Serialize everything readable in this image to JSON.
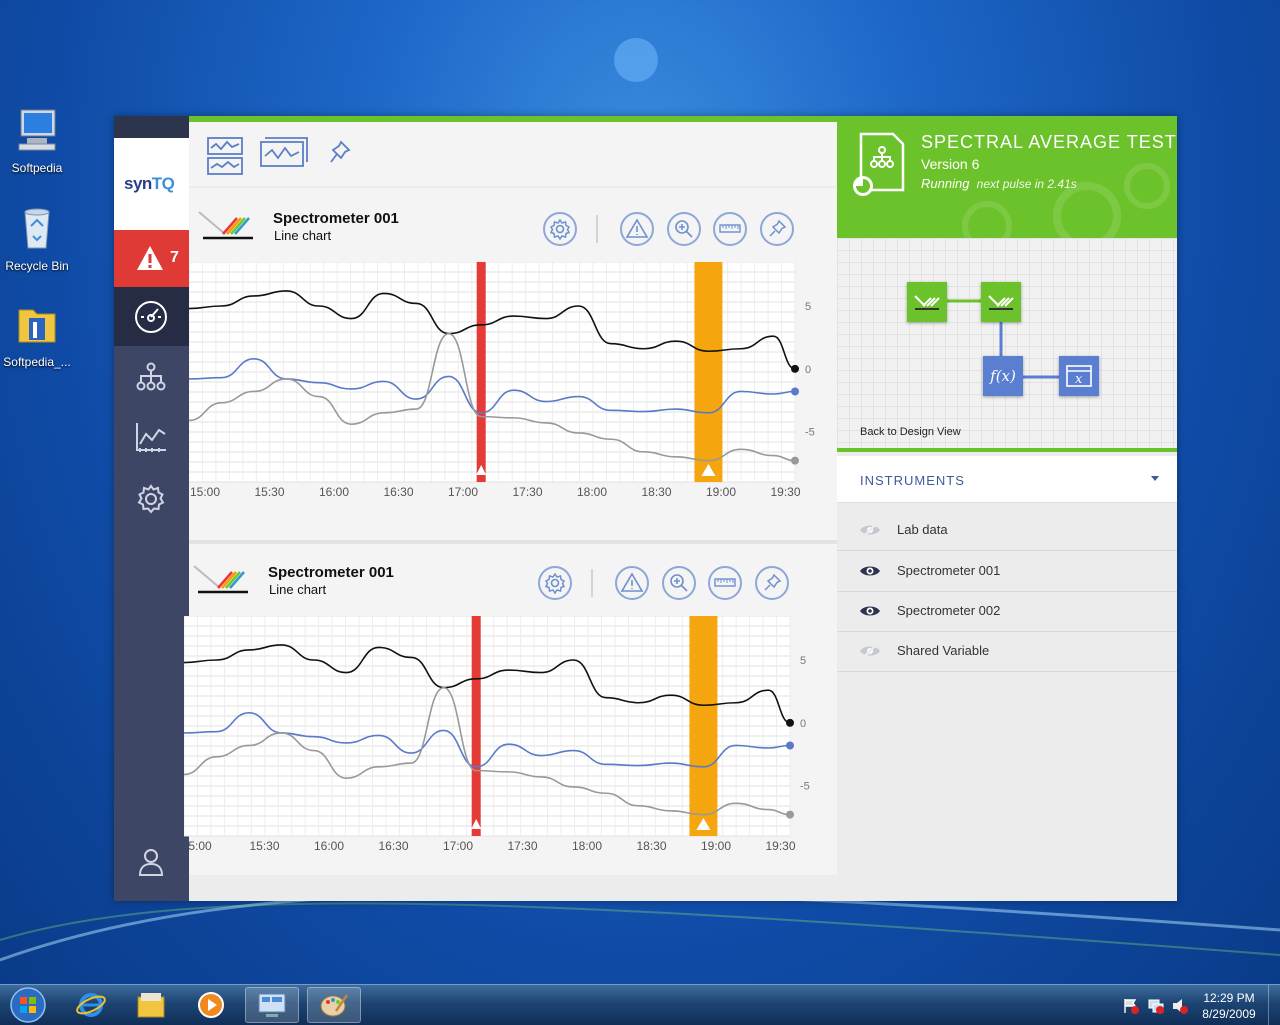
{
  "desktop": {
    "icons": [
      {
        "label": "Softpedia"
      },
      {
        "label": "Recycle Bin"
      },
      {
        "label": "Softpedia_..."
      }
    ]
  },
  "app": {
    "logo": {
      "prefix": "syn",
      "suffix": "TQ"
    },
    "alert_count": "7",
    "charts": [
      {
        "title": "Spectrometer 001",
        "subtitle": "Line chart",
        "x_ticks": [
          "15:00",
          "15:30",
          "16:00",
          "16:30",
          "17:00",
          "17:30",
          "18:00",
          "18:30",
          "19:00",
          "19:30"
        ],
        "y_ticks": [
          "5",
          "0",
          "-5"
        ]
      },
      {
        "title": "Spectrometer 001",
        "subtitle": "Line chart",
        "x_ticks": [
          "5:00",
          "15:30",
          "16:00",
          "16:30",
          "17:00",
          "17:30",
          "18:00",
          "18:30",
          "19:00",
          "19:30"
        ],
        "y_ticks": [
          "5",
          "0",
          "-5"
        ]
      }
    ],
    "chart_data": [
      {
        "type": "line",
        "title": "Spectrometer 001",
        "xlabel": "",
        "ylabel": "",
        "x": [
          "15:00",
          "15:15",
          "15:30",
          "15:45",
          "16:00",
          "16:15",
          "16:30",
          "16:45",
          "17:00",
          "17:15",
          "17:30",
          "17:45",
          "18:00",
          "18:15",
          "18:30",
          "18:45",
          "19:00",
          "19:15",
          "19:30",
          "19:40"
        ],
        "ylim": [
          -9,
          8.5
        ],
        "series": [
          {
            "color": "#111111",
            "values": [
              4.8,
              5.0,
              5.8,
              6.2,
              5.0,
              4.0,
              6.0,
              5.2,
              2.8,
              3.5,
              4.2,
              4.0,
              5.0,
              2.0,
              1.6,
              2.2,
              1.4,
              1.6,
              2.6,
              0.0
            ]
          },
          {
            "color": "#5a79c8",
            "values": [
              -0.8,
              -0.7,
              0.8,
              -0.8,
              -1.1,
              -1.6,
              -1.0,
              -2.4,
              -0.6,
              -3.5,
              -1.7,
              -2.6,
              -2.2,
              -3.3,
              -3.4,
              -3.2,
              -3.5,
              -1.8,
              -2.0,
              -1.8
            ]
          },
          {
            "color": "#999999",
            "values": [
              -4.1,
              -2.7,
              -1.8,
              -0.8,
              -2.2,
              -4.4,
              -3.5,
              -3.2,
              2.8,
              -3.8,
              -3.9,
              -4.3,
              -5.1,
              -5.6,
              -6.6,
              -7.0,
              -7.3,
              -6.4,
              -6.9,
              -7.3
            ]
          }
        ],
        "markers": [
          {
            "type": "alarm",
            "x": "17:15",
            "color": "#e53b36"
          },
          {
            "type": "warning",
            "x": "19:00",
            "color": "#f5a50d"
          }
        ]
      },
      {
        "type": "line",
        "title": "Spectrometer 001",
        "xlabel": "",
        "ylabel": "",
        "x": [
          "15:00",
          "15:15",
          "15:30",
          "15:45",
          "16:00",
          "16:15",
          "16:30",
          "16:45",
          "17:00",
          "17:15",
          "17:30",
          "17:45",
          "18:00",
          "18:15",
          "18:30",
          "18:45",
          "19:00",
          "19:15",
          "19:30",
          "19:40"
        ],
        "ylim": [
          -9,
          8.5
        ],
        "series": [
          {
            "color": "#111111",
            "values": [
              4.8,
              5.0,
              5.8,
              6.2,
              5.0,
              4.0,
              6.0,
              5.2,
              2.8,
              3.5,
              4.2,
              4.0,
              5.0,
              2.0,
              1.6,
              2.2,
              1.4,
              1.6,
              2.6,
              0.0
            ]
          },
          {
            "color": "#5a79c8",
            "values": [
              -0.8,
              -0.7,
              0.8,
              -0.8,
              -1.1,
              -1.6,
              -1.0,
              -2.4,
              -0.6,
              -3.5,
              -1.7,
              -2.6,
              -2.2,
              -3.3,
              -3.4,
              -3.2,
              -3.5,
              -1.8,
              -2.0,
              -1.8
            ]
          },
          {
            "color": "#999999",
            "values": [
              -4.1,
              -2.7,
              -1.8,
              -0.8,
              -2.2,
              -4.4,
              -3.5,
              -3.2,
              2.8,
              -3.8,
              -3.9,
              -4.3,
              -5.1,
              -5.6,
              -6.6,
              -7.0,
              -7.3,
              -6.4,
              -6.9,
              -7.3
            ]
          }
        ],
        "markers": [
          {
            "type": "alarm",
            "x": "17:15",
            "color": "#e53b36"
          },
          {
            "type": "warning",
            "x": "19:00",
            "color": "#f5a50d"
          }
        ]
      }
    ],
    "test": {
      "title": "SPECTRAL AVERAGE  TEST",
      "version": "Version 6",
      "status": "Running",
      "pulse": "next pulse in 2.41s",
      "back_link": "Back to Design View",
      "fx_label": "f(x)",
      "out_label": "x"
    },
    "instruments": {
      "header": "INSTRUMENTS",
      "items": [
        {
          "label": "Lab data",
          "visible": false
        },
        {
          "label": "Spectrometer 001",
          "visible": true
        },
        {
          "label": "Spectrometer 002",
          "visible": true
        },
        {
          "label": "Shared Variable",
          "visible": false
        }
      ]
    },
    "colors": {
      "accent_green": "#6cc22a",
      "sidebar": "#3e4666",
      "alarm_red": "#e53b36",
      "warning_orange": "#f5a50d",
      "link_blue": "#3e5a9a"
    }
  },
  "taskbar": {
    "time": "12:29 PM",
    "date": "8/29/2009"
  }
}
